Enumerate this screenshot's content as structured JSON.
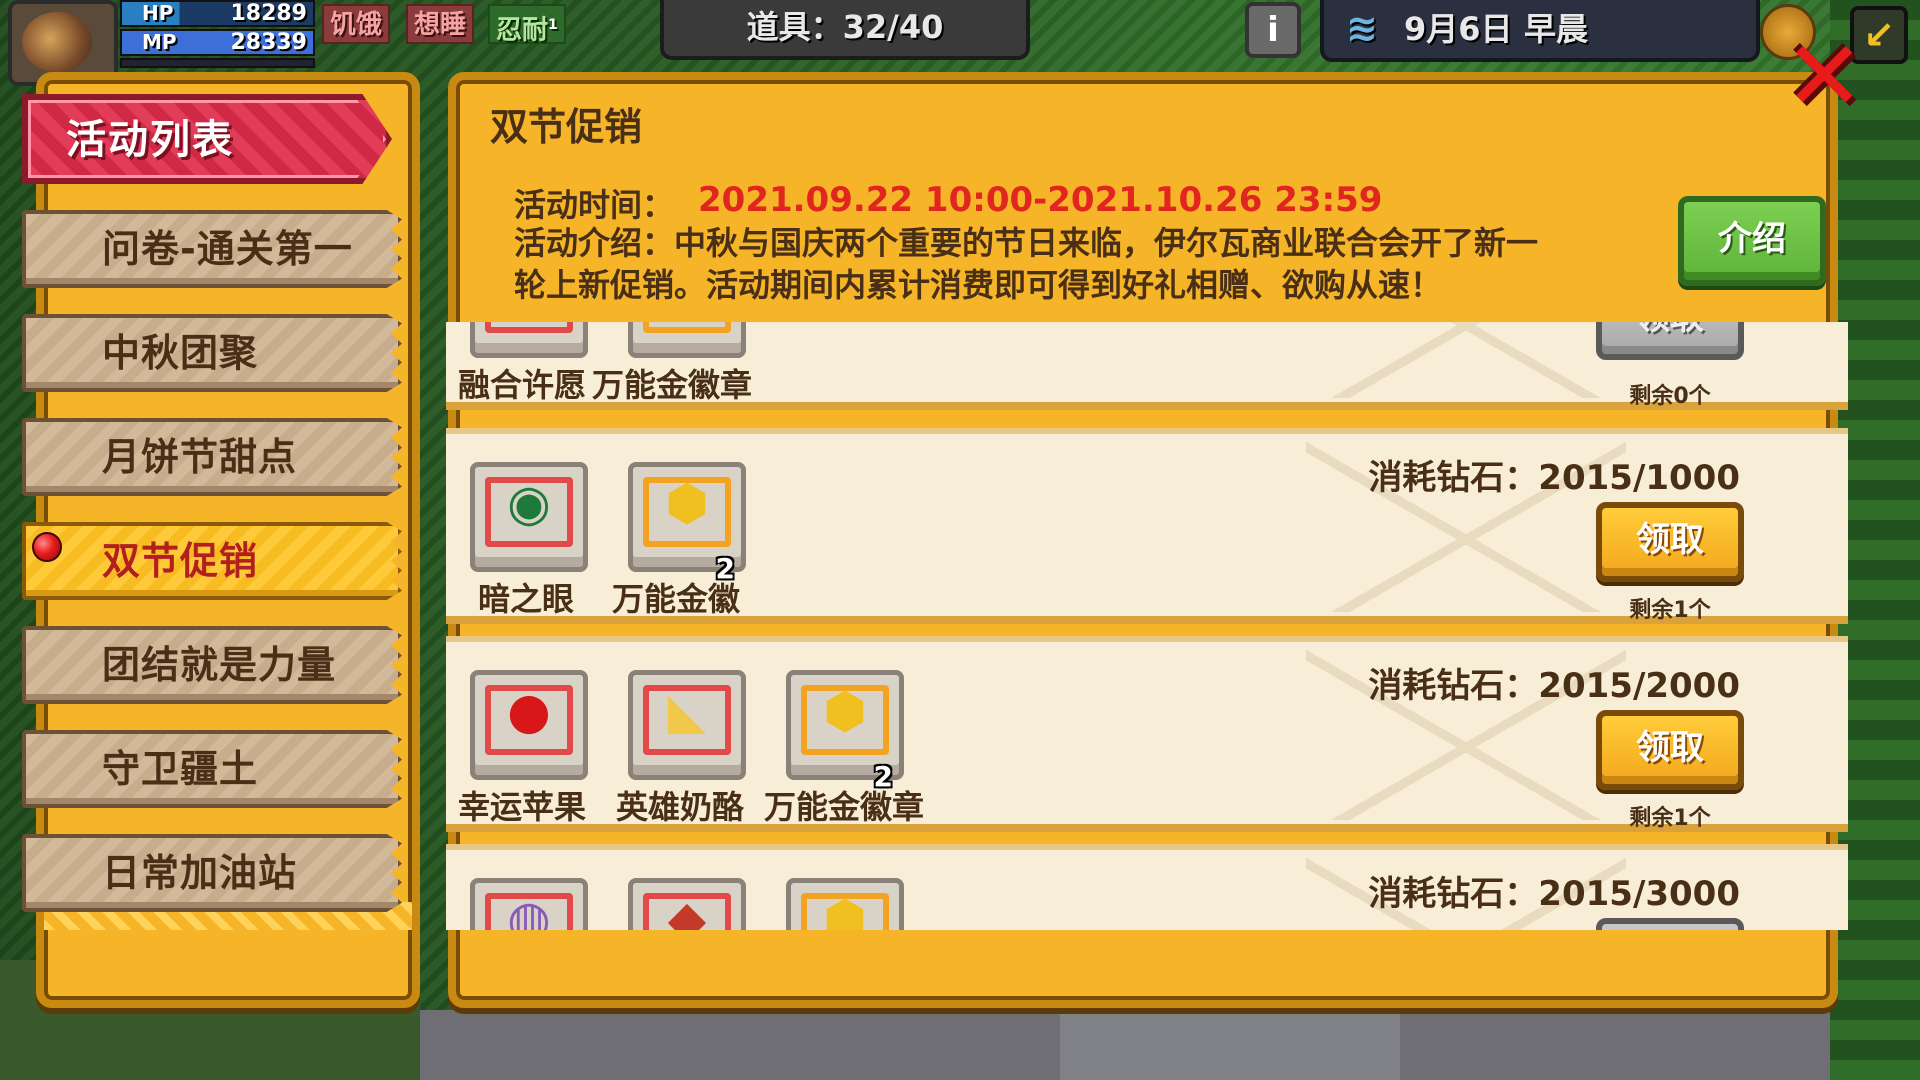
{
  "hud": {
    "hp_label": "HP",
    "hp_value": "18289",
    "mp_label": "MP",
    "mp_value": "28339",
    "status_tags": [
      "饥饿",
      "想睡",
      "忍耐"
    ],
    "status_tag_badge": "1",
    "items_count": "道具：32/40",
    "date": "9月6日",
    "time_of_day": "早晨",
    "info_icon": "i"
  },
  "sidebar": {
    "header": "活动列表",
    "items": [
      {
        "label": "问卷-通关第一",
        "active": false
      },
      {
        "label": "中秋团聚",
        "active": false
      },
      {
        "label": "月饼节甜点",
        "active": false
      },
      {
        "label": "双节促销",
        "active": true
      },
      {
        "label": "团结就是力量",
        "active": false
      },
      {
        "label": "守卫疆土",
        "active": false
      },
      {
        "label": "日常加油站",
        "active": false
      }
    ]
  },
  "event": {
    "title": "双节促销",
    "time_label": "活动时间：",
    "time_value": "2021.09.22 10:00-2021.10.26 23:59",
    "desc_line1": "活动介绍：中秋与国庆两个重要的节日来临，伊尔瓦商业联合会开了新一",
    "desc_line2": "轮上新促销。活动期间内累计消费即可得到好礼相赠、欲购从速！",
    "intro_button": "介绍"
  },
  "rewards": [
    {
      "cost": "",
      "items": [
        {
          "name": "融合许愿",
          "count": ""
        },
        {
          "name": "万能金徽章",
          "count": ""
        }
      ],
      "button": "领取",
      "button_enabled": false,
      "remaining": "剩余0个"
    },
    {
      "cost": "消耗钻石：2015/1000",
      "items": [
        {
          "name": "暗之眼",
          "count": ""
        },
        {
          "name": "万能金徽",
          "count": "2"
        }
      ],
      "button": "领取",
      "button_enabled": true,
      "remaining": "剩余1个"
    },
    {
      "cost": "消耗钻石：2015/2000",
      "items": [
        {
          "name": "幸运苹果",
          "count": ""
        },
        {
          "name": "英雄奶酪",
          "count": ""
        },
        {
          "name": "万能金徽章",
          "count": "2"
        }
      ],
      "button": "领取",
      "button_enabled": true,
      "remaining": "剩余1个"
    },
    {
      "cost": "消耗钻石：2015/3000",
      "items": [
        {
          "name": "",
          "count": ""
        },
        {
          "name": "",
          "count": ""
        },
        {
          "name": "",
          "count": ""
        }
      ],
      "button": "",
      "button_enabled": false,
      "remaining": ""
    }
  ],
  "icons": {
    "close": "close-icon",
    "weather": "wind-icon",
    "globe": "globe-icon",
    "exit": "exit-icon"
  },
  "colors": {
    "panel": "#f6b429",
    "header_tab": "#e23d58",
    "time_value": "#e0261f",
    "intro_button": "#6cc244",
    "claim_button": "#f7b52a"
  }
}
